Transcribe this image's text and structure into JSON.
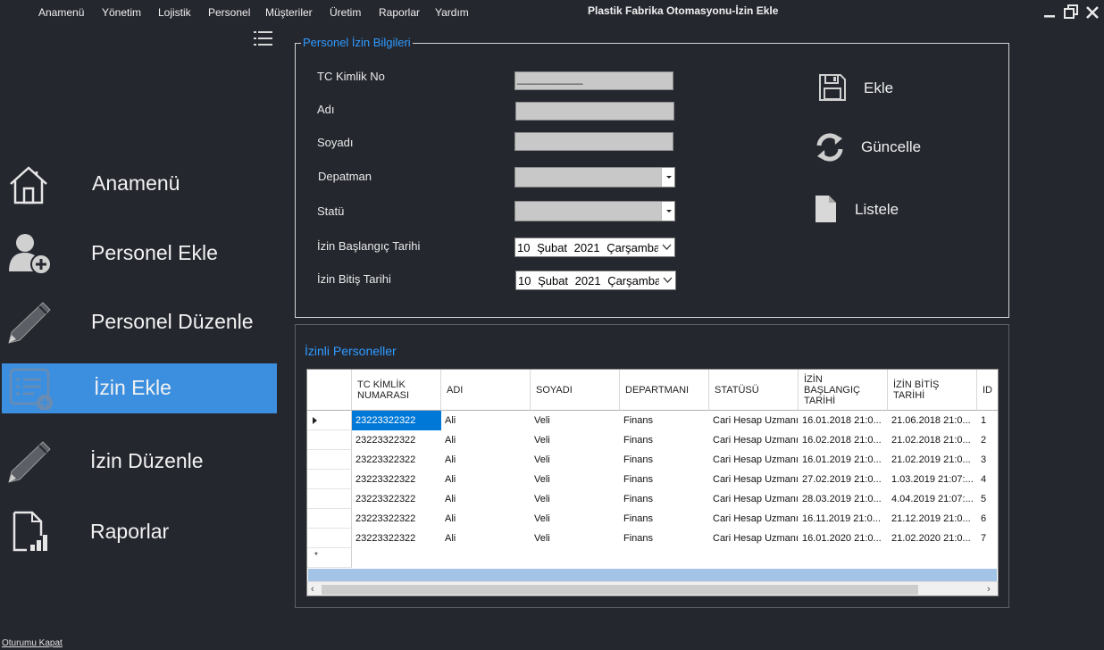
{
  "window": {
    "title": "Plastik Fabrika Otomasyonu-İzin Ekle"
  },
  "menu": {
    "items": [
      "Anamenü",
      "Yönetim",
      "Lojistik",
      "Personel",
      "Müşteriler",
      "Üretim",
      "Raporlar",
      "Yardım"
    ]
  },
  "sidebar": {
    "items": [
      {
        "label": "Anamenü",
        "icon": "home-icon"
      },
      {
        "label": "Personel Ekle",
        "icon": "add-user-icon"
      },
      {
        "label": "Personel Düzenle",
        "icon": "pencil-icon"
      },
      {
        "label": "İzin Ekle",
        "icon": "form-add-icon",
        "active": true
      },
      {
        "label": "İzin Düzenle",
        "icon": "pencil-icon"
      },
      {
        "label": "Raporlar",
        "icon": "report-icon"
      }
    ],
    "logout": "Oturumu Kapat"
  },
  "form": {
    "group_title": "Personel İzin Bilgileri",
    "labels": {
      "tc": "TC Kimlik No",
      "name": "Adı",
      "surname": "Soyadı",
      "department": "Depatman",
      "status": "Statü",
      "start": "İzin Başlangıç Tarihi",
      "end": "İzin Bitiş Tarihi"
    },
    "tc_value": "___________",
    "start_date": "10   Şubat   2021 Çarşamba",
    "end_date": "10   Şubat   2021 Çarşamba"
  },
  "actions": {
    "add": "Ekle",
    "update": "Güncelle",
    "list": "Listele"
  },
  "list": {
    "group_title": "İzinli Personeller",
    "columns": [
      "TC KİMLİK NUMARASI",
      "ADI",
      "SOYADI",
      "DEPARTMANI",
      "STATÜSÜ",
      "İZİN BAŞLANGIÇ TARİHİ",
      "İZİN BİTİŞ TARİHİ",
      "ID"
    ],
    "rows": [
      [
        "23223322322",
        "Ali",
        "Veli",
        "Finans",
        "Cari Hesap Uzmanı",
        "16.01.2018 21:0...",
        "21.06.2018 21:0...",
        "1"
      ],
      [
        "23223322322",
        "Ali",
        "Veli",
        "Finans",
        "Cari Hesap Uzmanı",
        "16.02.2018 21:0...",
        "21.02.2018 21:0...",
        "2"
      ],
      [
        "23223322322",
        "Ali",
        "Veli",
        "Finans",
        "Cari Hesap Uzmanı",
        "16.01.2019 21:0...",
        "21.02.2019 21:0...",
        "3"
      ],
      [
        "23223322322",
        "Ali",
        "Veli",
        "Finans",
        "Cari Hesap Uzmanı",
        "27.02.2019 21:0...",
        "1.03.2019 21:07:...",
        "4"
      ],
      [
        "23223322322",
        "Ali",
        "Veli",
        "Finans",
        "Cari Hesap Uzmanı",
        "28.03.2019 21:0...",
        "4.04.2019 21:07:...",
        "5"
      ],
      [
        "23223322322",
        "Ali",
        "Veli",
        "Finans",
        "Cari Hesap Uzmanı",
        "16.11.2019 21:0...",
        "21.12.2019 21:0...",
        "6"
      ],
      [
        "23223322322",
        "Ali",
        "Veli",
        "Finans",
        "Cari Hesap Uzmanı",
        "16.01.2020 21:0...",
        "21.02.2020 21:0...",
        "7"
      ]
    ]
  },
  "colors": {
    "background": "#25272f",
    "accent": "#3c8fdf",
    "group_title": "#2e9bff",
    "selection": "#0078d7"
  }
}
